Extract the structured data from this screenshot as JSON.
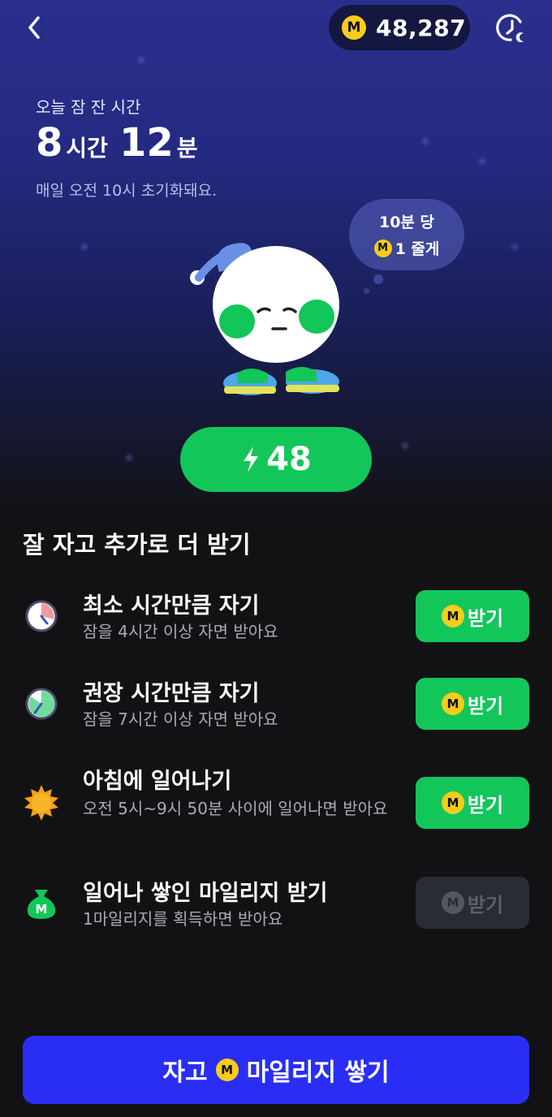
{
  "header": {
    "points": "48,287",
    "coin_symbol": "M",
    "back_icon": "chevron-left-icon",
    "history_icon": "clock-moon-icon"
  },
  "sleep": {
    "label": "오늘 잠 잔 시간",
    "hours": "8",
    "hours_unit": "시간",
    "minutes": "12",
    "minutes_unit": "분",
    "reset_note": "매일 오전 10시 초기화돼요."
  },
  "bubble": {
    "line1": "10분 당",
    "coin_symbol": "M",
    "line2": "1 줄게"
  },
  "energy": {
    "value": "48",
    "icon": "lightning-icon"
  },
  "section": {
    "title": "잘 자고 추가로 더 받기"
  },
  "missions": [
    {
      "title": "최소 시간만큼 자기",
      "desc": "잠을 4시간 이상 자면 받아요",
      "button": "받기",
      "coin_symbol": "M",
      "enabled": true,
      "icon": "clock-icon"
    },
    {
      "title": "권장 시간만큼 자기",
      "desc": "잠을 7시간 이상 자면 받아요",
      "button": "받기",
      "coin_symbol": "M",
      "enabled": true,
      "icon": "clock-full-icon"
    },
    {
      "title": "아침에 일어나기",
      "desc": "오전 5시~9시 50분 사이에 일어나면 받아요",
      "button": "받기",
      "coin_symbol": "M",
      "enabled": true,
      "icon": "sun-icon"
    },
    {
      "title": "일어나 쌓인 마일리지 받기",
      "desc": "1마일리지를 획득하면 받아요",
      "button": "받기",
      "coin_symbol": "M",
      "enabled": false,
      "icon": "money-bag-icon"
    }
  ],
  "cta": {
    "left": "자고",
    "coin_symbol": "M",
    "right": "마일리지 쌓기"
  },
  "colors": {
    "accent_green": "#12c65a",
    "coin_yellow": "#f8cc1c",
    "cta_blue": "#2a2ef5",
    "background": "#121214"
  }
}
